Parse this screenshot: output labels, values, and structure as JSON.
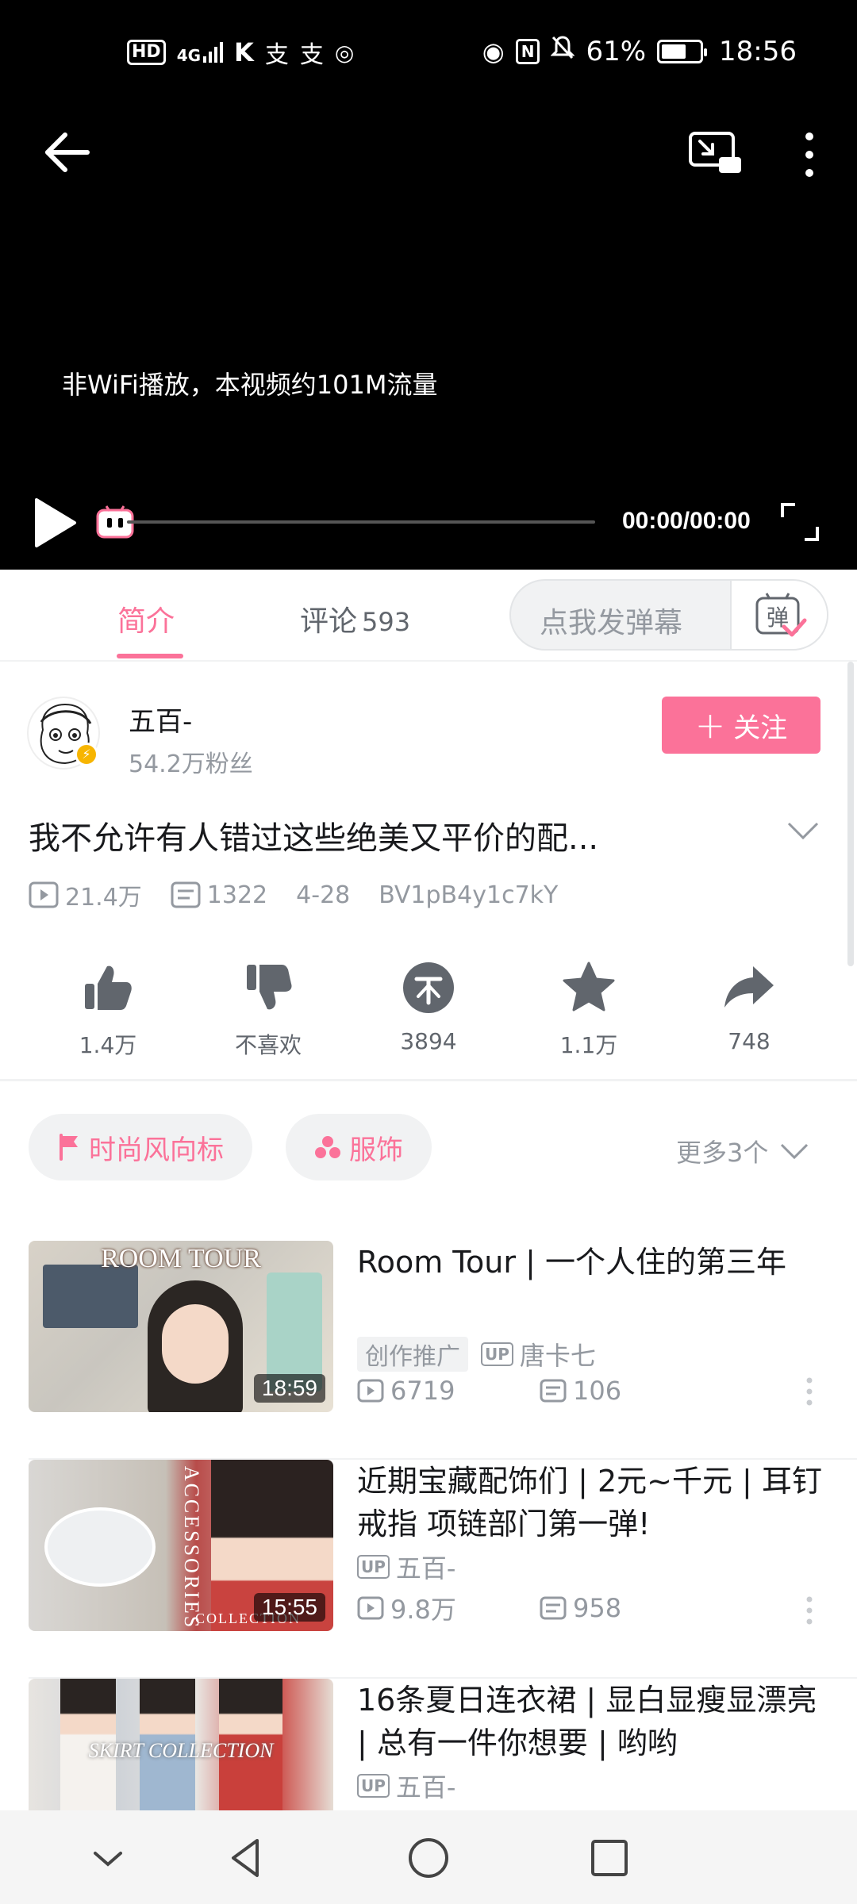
{
  "status_bar": {
    "left_icons": [
      "hd-icon",
      "signal-4g-icon",
      "k-app-icon",
      "alipay-icon",
      "alipay-icon",
      "wifi-hotspot-icon"
    ],
    "hd_label": "HD",
    "signal_label": "4G",
    "battery": "61%",
    "time": "18:56"
  },
  "player": {
    "flow_note": "非WiFi播放，本视频约101M流量",
    "time": "00:00/00:00",
    "progress": 0
  },
  "tabs": {
    "intro": "简介",
    "comments": "评论",
    "comments_count": "593",
    "danmaku_placeholder": "点我发弹幕",
    "danmaku_icon_char": "弹"
  },
  "uploader": {
    "name": "五百-",
    "fans": "54.2万粉丝",
    "follow_label": "关注"
  },
  "video": {
    "title": "我不允许有人错过这些绝美又平价的配...",
    "views": "21.4万",
    "danmaku": "1322",
    "date": "4-28",
    "bvid": "BV1pB4y1c7kY"
  },
  "actions": {
    "like": "1.4万",
    "dislike": "不喜欢",
    "coin": "3894",
    "favorite": "1.1万",
    "share": "748"
  },
  "tags": {
    "tag1": "时尚风向标",
    "tag2": "服饰",
    "more": "更多3个"
  },
  "related": [
    {
      "title": "Room Tour | 一个人住的第三年",
      "thumb_text": "ROOM TOUR",
      "duration": "18:59",
      "promo": "创作推广",
      "up_badge": "UP",
      "uploader": "唐卡七",
      "views": "6719",
      "danmaku": "106"
    },
    {
      "title": "近期宝藏配饰们 | 2元~千元 | 耳钉 戒指 项链部门第一弹!",
      "thumb_text": "ACCESSORIES",
      "thumb_text2": "COLLECTION",
      "duration": "15:55",
      "up_badge": "UP",
      "uploader": "五百-",
      "views": "9.8万",
      "danmaku": "958"
    },
    {
      "title": "16条夏日连衣裙 | 显白显瘦显漂亮 | 总有一件你想要 | 哟哟",
      "thumb_text": "SKIRT COLLECTION",
      "up_badge": "UP",
      "uploader": "五百-"
    }
  ],
  "colors": {
    "accent": "#fb7299",
    "text_primary": "#18191c",
    "text_secondary": "#9499a0",
    "background": "#ffffff",
    "player_background": "#000000"
  }
}
